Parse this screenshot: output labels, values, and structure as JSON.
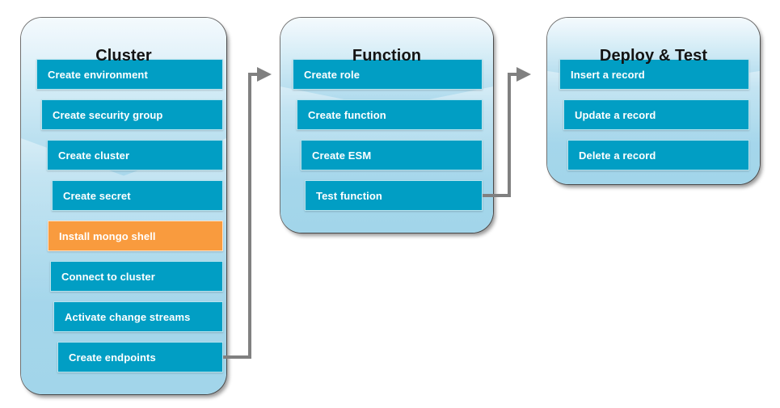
{
  "diagram": {
    "title": "Cluster / Function / Deploy & Test workflow",
    "colors": {
      "step_blue": "#019EC4",
      "step_highlight_orange": "#F99B3E",
      "container_top": "#F4FAFD",
      "container_bottom": "#A2D5EA",
      "connector_gray": "#808080",
      "title_text": "#131313",
      "step_text": "#FFFFFF"
    },
    "columns": [
      {
        "id": "cluster",
        "title": "Cluster",
        "steps": [
          {
            "label": "Create environment",
            "highlighted": false
          },
          {
            "label": "Create security group",
            "highlighted": false
          },
          {
            "label": "Create cluster",
            "highlighted": false
          },
          {
            "label": "Create secret",
            "highlighted": false
          },
          {
            "label": "Install mongo shell",
            "highlighted": true
          },
          {
            "label": "Connect to cluster",
            "highlighted": false
          },
          {
            "label": "Activate change streams",
            "highlighted": false
          },
          {
            "label": "Create endpoints",
            "highlighted": false
          }
        ]
      },
      {
        "id": "function",
        "title": "Function",
        "steps": [
          {
            "label": "Create role",
            "highlighted": false
          },
          {
            "label": "Create function",
            "highlighted": false
          },
          {
            "label": "Create ESM",
            "highlighted": false
          },
          {
            "label": "Test function",
            "highlighted": false
          }
        ]
      },
      {
        "id": "deploy-test",
        "title": "Deploy & Test",
        "steps": [
          {
            "label": "Insert a record",
            "highlighted": false
          },
          {
            "label": "Update a record",
            "highlighted": false
          },
          {
            "label": "Delete a record",
            "highlighted": false
          }
        ]
      }
    ],
    "connectors": [
      {
        "id": "cluster-to-function",
        "from": "Create endpoints",
        "to": "Create role"
      },
      {
        "id": "function-to-deploy-test",
        "from": "Test function",
        "to": "Insert a record"
      }
    ]
  }
}
